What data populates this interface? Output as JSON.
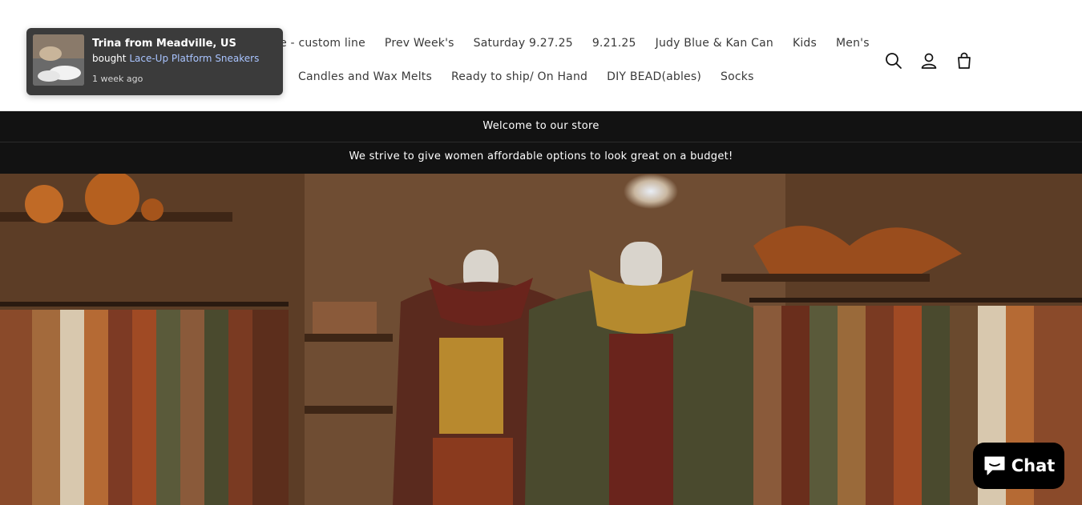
{
  "nav": {
    "row1": [
      "ue - custom line",
      "Prev Week's",
      "Saturday 9.27.25",
      "9.21.25",
      "Judy Blue & Kan Can",
      "Kids",
      "Men's"
    ],
    "row2": [
      "Candles and Wax Melts",
      "Ready to ship/ On Hand",
      "DIY BEAD(ables)",
      "Socks"
    ]
  },
  "header_icons": [
    "search-icon",
    "account-icon",
    "cart-icon"
  ],
  "announcements": {
    "welcome": "Welcome to our store",
    "tagline": "We strive to give women affordable options to look great on a budget!"
  },
  "popup": {
    "who": "Trina from Meadville, US",
    "bought_prefix": "bought",
    "product": "Lace-Up Platform Sneakers",
    "when": "1 week ago"
  },
  "chat": {
    "label": "Chat"
  },
  "colors": {
    "bar": "#121212",
    "popup_bg": "#3b3b3b",
    "link": "#a9c4ff",
    "chat_bg": "#000000"
  }
}
